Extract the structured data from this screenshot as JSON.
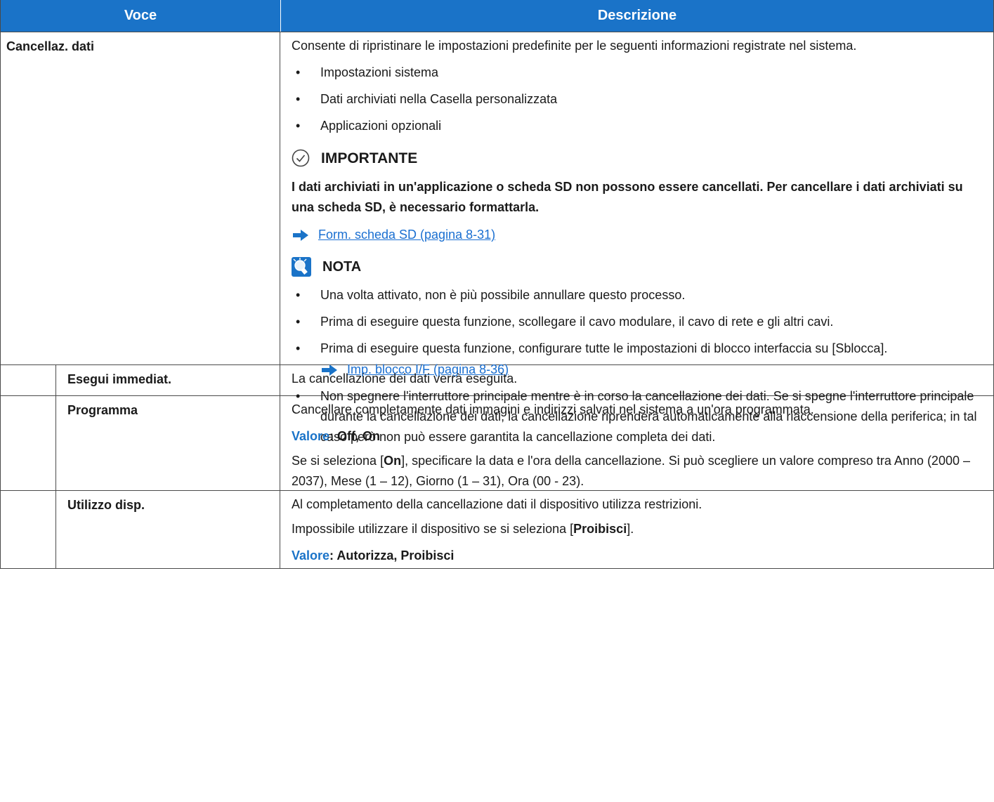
{
  "header": {
    "col1": "Voce",
    "col2": "Descrizione"
  },
  "rows": {
    "cancellaz": {
      "label": "Cancellaz. dati",
      "intro": "Consente di ripristinare le impostazioni predefinite per le seguenti informazioni registrate nel sistema.",
      "bullets": [
        "Impostazioni sistema",
        "Dati archiviati nella Casella personalizzata",
        "Applicazioni opzionali"
      ],
      "important_title": "IMPORTANTE",
      "important_text": "I dati archiviati in un'applicazione o scheda SD non possono essere cancellati. Per cancellare i dati archiviati su una scheda SD, è necessario formattarla.",
      "link1": "Form. scheda SD (pagina 8-31)",
      "nota_title": "NOTA",
      "nota_bullets": [
        "Una volta attivato, non è più possibile annullare questo processo.",
        "Prima di eseguire questa funzione, scollegare il cavo modulare, il cavo di rete e gli altri cavi.",
        "Prima di eseguire questa funzione, configurare tutte le impostazioni di blocco interfaccia su [Sblocca].",
        "Non spegnere l'interruttore principale mentre è in corso la cancellazione dei dati. Se si spegne l'interruttore principale durante la cancellazione dei dati, la cancellazione riprenderà automaticamente alla riaccensione della periferica; in tal caso però non può essere garantita la cancellazione completa dei dati."
      ],
      "link2": "Imp. blocco I/F (pagina 8-36)"
    },
    "esegui": {
      "label": "Esegui immediat.",
      "text": "La cancellazione dei dati verrà eseguita."
    },
    "programma": {
      "label": "Programma",
      "text": "Cancellare completamente dati immagini e indirizzi salvati nel sistema a un'ora programmata.",
      "valore_key": "Valore",
      "valore_val": ": Off, On",
      "text2_a": "Se si seleziona [",
      "text2_b": "On",
      "text2_c": "], specificare la data e l'ora della cancellazione. Si può scegliere un valore compreso tra Anno (2000 – 2037), Mese (1 – 12), Giorno (1 – 31), Ora (00 - 23)."
    },
    "utilizzo": {
      "label": "Utilizzo disp.",
      "text": "Al completamento della cancellazione dati il dispositivo utilizza restrizioni.",
      "text2_a": "Impossibile utilizzare il dispositivo se si seleziona [",
      "text2_b": "Proibisci",
      "text2_c": "].",
      "valore_key": "Valore",
      "valore_val": ": Autorizza, Proibisci"
    }
  },
  "bullet_char": "•",
  "colors": {
    "header_bg": "#1a73c8",
    "link": "#1a6fd1",
    "valore": "#1a73c8"
  }
}
